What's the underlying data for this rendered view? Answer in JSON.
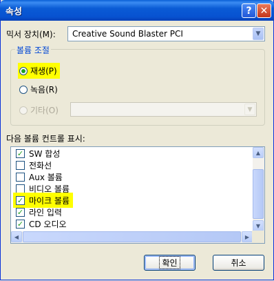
{
  "window": {
    "title": "속성",
    "help_glyph": "?",
    "close_glyph": "✕"
  },
  "mixer": {
    "label": "믹서 장치(M):",
    "value": "Creative Sound Blaster PCI"
  },
  "volume_group": {
    "title": "볼륨 조절",
    "options": [
      {
        "label": "재생(P)",
        "checked": true,
        "disabled": false,
        "highlighted": true
      },
      {
        "label": "녹음(R)",
        "checked": false,
        "disabled": false,
        "highlighted": false
      },
      {
        "label": "기타(O)",
        "checked": false,
        "disabled": true,
        "highlighted": false
      }
    ]
  },
  "controls_label": "다음 볼륨 컨트롤 표시:",
  "controls": [
    {
      "label": "SW 합성",
      "checked": true
    },
    {
      "label": "전화선",
      "checked": false
    },
    {
      "label": "Aux 볼륨",
      "checked": false
    },
    {
      "label": "비디오 볼륨",
      "checked": false
    },
    {
      "label": "마이크 볼륨",
      "checked": true,
      "highlighted": true
    },
    {
      "label": "라인 입력",
      "checked": true
    },
    {
      "label": "CD 오디오",
      "checked": true
    }
  ],
  "buttons": {
    "ok": "확인",
    "cancel": "취소"
  },
  "colors": {
    "title_bar": "#0a5bd5",
    "accent": "#21a121",
    "highlight": "#ffff00",
    "group_title": "#0046d5"
  }
}
